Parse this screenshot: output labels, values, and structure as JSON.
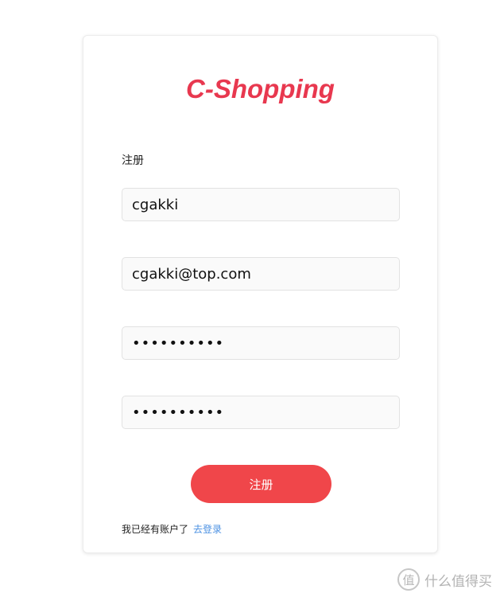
{
  "app": {
    "logo_text": "C-Shopping",
    "brand_color": "#e8384f"
  },
  "register_form": {
    "title": "注册",
    "username_value": "cgakki",
    "email_value": "cgakki@top.com",
    "password_value": "••••••••••",
    "confirm_password_value": "••••••••••",
    "submit_label": "注册",
    "submit_color": "#f0464a"
  },
  "footer": {
    "has_account_text": "我已经有账户了",
    "login_link_text": "去登录",
    "link_color": "#4a90e2"
  },
  "watermark": {
    "icon_glyph": "值",
    "text": "什么值得买"
  }
}
